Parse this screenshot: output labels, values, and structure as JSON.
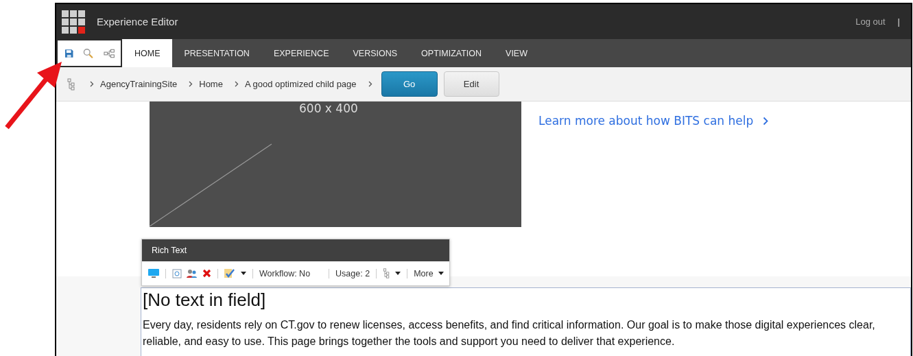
{
  "header": {
    "title": "Experience Editor",
    "logout": "Log out",
    "separator": "|"
  },
  "ribbon_tabs": [
    {
      "label": "HOME",
      "selected": true
    },
    {
      "label": "PRESENTATION",
      "selected": false
    },
    {
      "label": "EXPERIENCE",
      "selected": false
    },
    {
      "label": "VERSIONS",
      "selected": false
    },
    {
      "label": "OPTIMIZATION",
      "selected": false
    },
    {
      "label": "VIEW",
      "selected": false
    }
  ],
  "breadcrumb": {
    "items": [
      "AgencyTrainingSite",
      "Home",
      "A good optimized child page"
    ],
    "go_button": "Go",
    "edit_button": "Edit"
  },
  "content": {
    "image_label": "600 x 400",
    "link": "Learn more about how BITS can help"
  },
  "field_toolbar": {
    "title": "Rich Text",
    "workflow": "Workflow: No",
    "usage": "Usage: 2",
    "more": "More"
  },
  "field": {
    "heading": "[No text in field]",
    "paragraph": "Every day, residents rely on CT.gov to renew licenses, access benefits, and find critical information. Our goal is to make those digital experiences clear, reliable, and easy to use. This page brings together the tools and support you need to deliver that experience."
  }
}
